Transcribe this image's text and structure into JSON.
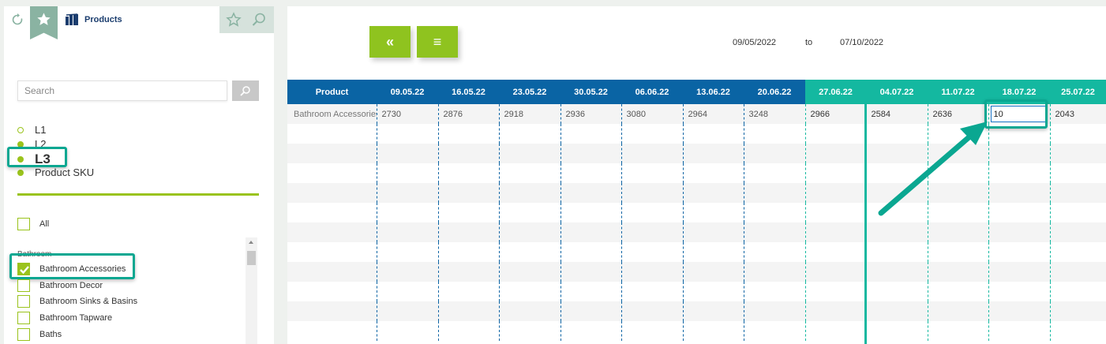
{
  "header": {
    "title": "Products",
    "icons": [
      "refresh-icon",
      "star-icon",
      "layers-icon",
      "star-outline-icon",
      "search-icon"
    ]
  },
  "sidebar": {
    "search_placeholder": "Search",
    "levels": [
      {
        "label": "L1",
        "selected": false
      },
      {
        "label": "L2",
        "selected": true
      },
      {
        "label": "L3",
        "selected": true
      },
      {
        "label": "Product SKU",
        "selected": true
      }
    ],
    "all_label": "All",
    "group_label": "Bathroom",
    "categories": [
      {
        "label": "Bathroom Accessories",
        "checked": true
      },
      {
        "label": "Bathroom Decor",
        "checked": false
      },
      {
        "label": "Bathroom Sinks & Basins",
        "checked": false
      },
      {
        "label": "Bathroom Tapware",
        "checked": false
      },
      {
        "label": "Baths",
        "checked": false
      }
    ]
  },
  "toolbar": {
    "back_label": "«",
    "menu_label": "≡"
  },
  "date_range": {
    "from": "09/05/2022",
    "to_label": "to",
    "to": "07/10/2022"
  },
  "grid": {
    "product_header": "Product",
    "weeks": [
      "09.05.22",
      "16.05.22",
      "23.05.22",
      "30.05.22",
      "06.06.22",
      "13.06.22",
      "20.06.22",
      "27.06.22",
      "04.07.22",
      "11.07.22",
      "18.07.22",
      "25.07.22"
    ],
    "rows": [
      {
        "product": "Bathroom Accessories",
        "values": [
          "2730",
          "2876",
          "2918",
          "2936",
          "3080",
          "2964",
          "3248",
          "2966",
          "2584",
          "2636",
          "10",
          "2043"
        ]
      }
    ],
    "editing_value": "10"
  },
  "colors": {
    "accent_green": "#8fc31f",
    "header_blue": "#0a64a4",
    "future_teal": "#14b8a0",
    "highlight": "#0aa791"
  }
}
